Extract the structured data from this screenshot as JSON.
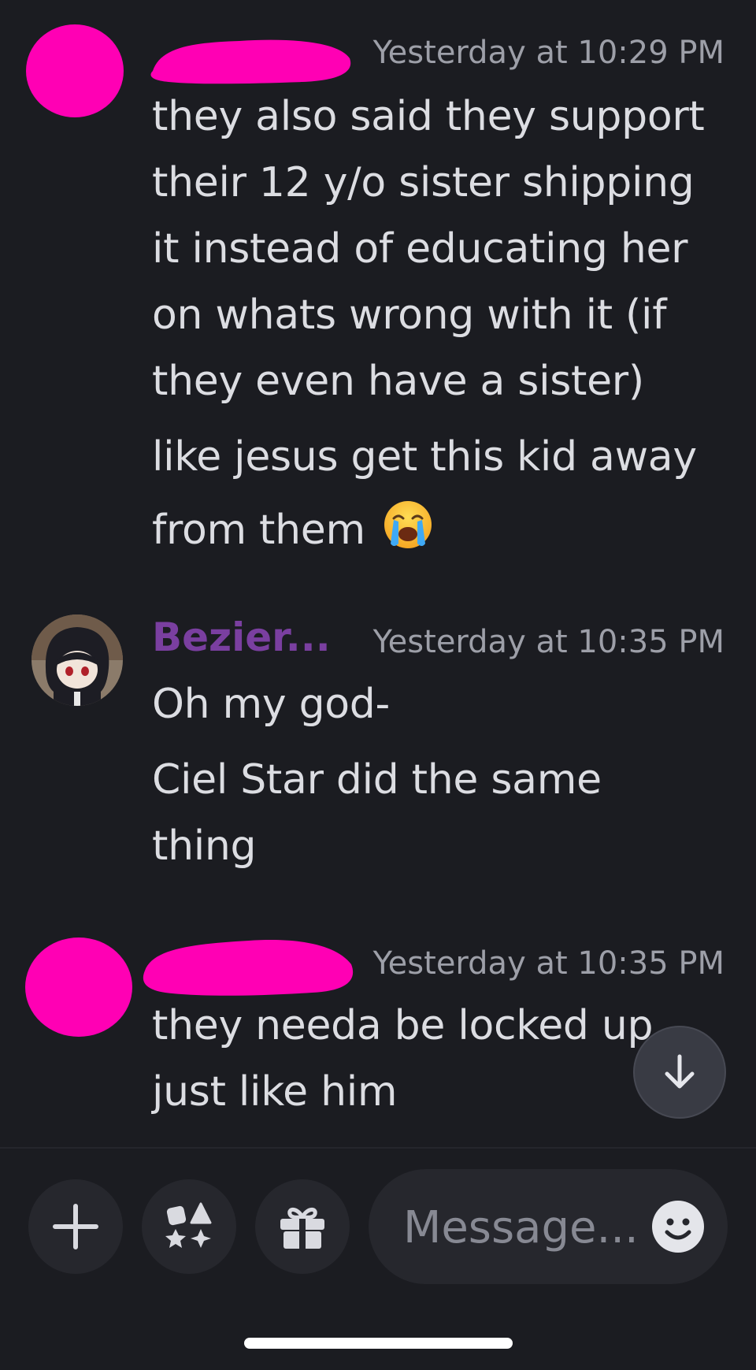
{
  "messages": [
    {
      "author": "",
      "author_redacted": true,
      "timestamp": "Yesterday at 10:29 PM",
      "lines": [
        "they also said they support",
        "their 12 y/o sister shipping",
        "it instead of educating her",
        "on whats wrong with it (if",
        "they even have a sister)",
        "like jesus get this kid away",
        "from them"
      ],
      "emoji": "loudly-crying-face"
    },
    {
      "author": "Bezier...",
      "author_redacted": false,
      "timestamp": "Yesterday at 10:35 PM",
      "lines": [
        "Oh my god-",
        "Ciel Star did the same",
        "thing"
      ]
    },
    {
      "author": "",
      "author_redacted": true,
      "timestamp": "Yesterday at 10:35 PM",
      "lines": [
        "they needa be locked up",
        "just like him"
      ]
    }
  ],
  "composer": {
    "placeholder": "Message...",
    "buttons": [
      "plus-icon",
      "apps-icon",
      "gift-icon",
      "emoji-icon"
    ]
  },
  "colors": {
    "background": "#1b1c21",
    "redaction": "#ff00b4",
    "username": "#7a3fa0",
    "timestamp": "#9d9fa8",
    "text": "#dcdde2"
  }
}
